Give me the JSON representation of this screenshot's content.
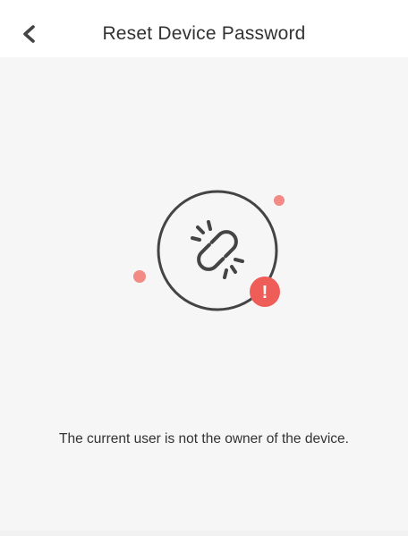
{
  "header": {
    "title": "Reset Device Password",
    "back_icon": "chevron-left-icon"
  },
  "illustration": {
    "icon": "broken-link-icon",
    "badge_icon": "exclamation-badge-icon",
    "badge_text": "!",
    "accent_color": "#ee5d58",
    "dot_color": "#f28a86"
  },
  "message": {
    "text": "The current user is not the owner of the device."
  },
  "colors": {
    "background": "#f6f6f6",
    "header_bg": "#ffffff",
    "text": "#333333"
  }
}
